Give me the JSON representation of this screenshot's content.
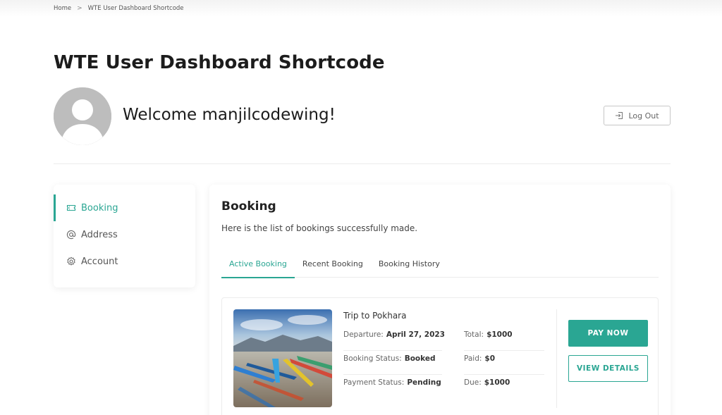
{
  "breadcrumb": {
    "home": "Home",
    "separator": ">",
    "current": "WTE User Dashboard Shortcode"
  },
  "page": {
    "title": "WTE User Dashboard Shortcode"
  },
  "user": {
    "welcome": "Welcome manjilcodewing!"
  },
  "header": {
    "logout_label": "Log Out"
  },
  "sidebar": {
    "items": [
      {
        "label": "Booking",
        "icon": "ticket-icon",
        "active": true
      },
      {
        "label": "Address",
        "icon": "at-icon",
        "active": false
      },
      {
        "label": "Account",
        "icon": "gear-icon",
        "active": false
      }
    ]
  },
  "main": {
    "title": "Booking",
    "description": "Here is the list of bookings successfully made.",
    "tabs": [
      {
        "label": "Active Booking",
        "active": true
      },
      {
        "label": "Recent Booking",
        "active": false
      },
      {
        "label": "Booking History",
        "active": false
      }
    ]
  },
  "booking": {
    "trip_name": "Trip to Pokhara",
    "departure_label": "Departure:",
    "departure_value": "April 27, 2023",
    "status_label": "Booking Status:",
    "status_value": "Booked",
    "payment_label": "Payment Status:",
    "payment_value": "Pending",
    "total_label": "Total:",
    "total_value": "$1000",
    "paid_label": "Paid:",
    "paid_value": "$0",
    "due_label": "Due:",
    "due_value": "$1000",
    "pay_now_label": "PAY NOW",
    "view_details_label": "VIEW DETAILS"
  },
  "colors": {
    "accent": "#2aa693",
    "text": "#222222",
    "muted": "#666666",
    "border": "#ececec"
  }
}
